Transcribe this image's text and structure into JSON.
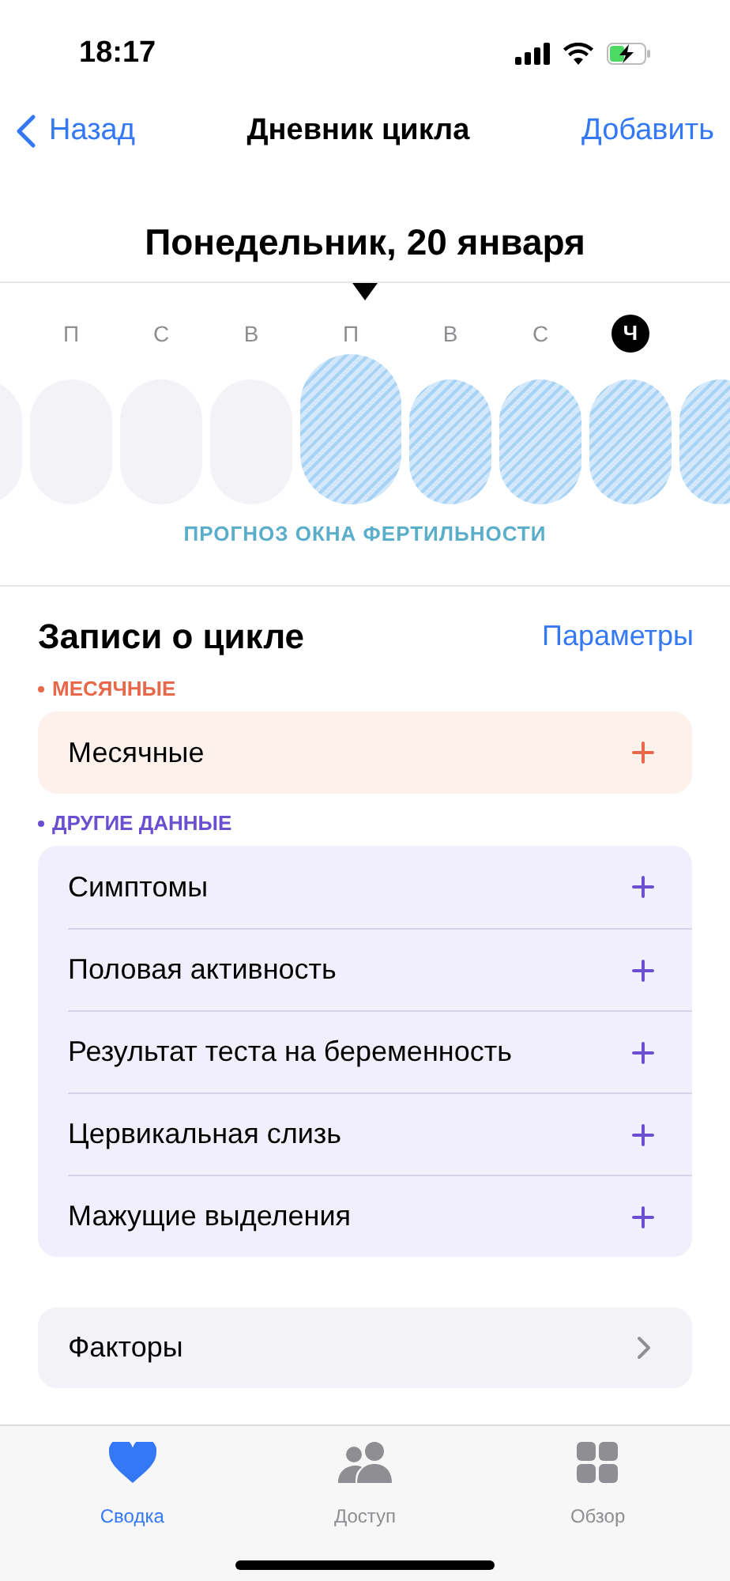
{
  "status_bar": {
    "time": "18:17"
  },
  "nav": {
    "back": "Назад",
    "title": "Дневник цикла",
    "action": "Добавить"
  },
  "date_title": "Понедельник, 20 января",
  "days": [
    {
      "kind": "empty",
      "selected": false
    },
    {
      "label": "П",
      "kind": "empty",
      "selected": false,
      "today": false
    },
    {
      "label": "С",
      "kind": "empty",
      "selected": false,
      "today": false
    },
    {
      "label": "В",
      "kind": "empty",
      "selected": false,
      "today": false
    },
    {
      "label": "П",
      "kind": "fertile",
      "selected": true,
      "today": false
    },
    {
      "label": "В",
      "kind": "fertile",
      "selected": false,
      "today": false
    },
    {
      "label": "С",
      "kind": "fertile",
      "selected": false,
      "today": false
    },
    {
      "label": "Ч",
      "kind": "fertile",
      "selected": false,
      "today": true
    },
    {
      "kind": "fertile",
      "selected": false
    }
  ],
  "legend": "ПРОГНОЗ ОКНА ФЕРТИЛЬНОСТИ",
  "section": {
    "title": "Записи о цикле",
    "action": "Параметры"
  },
  "groups": [
    {
      "title": "МЕСЯЧНЫЕ",
      "color": "#e8684a",
      "items": [
        "Месячные"
      ]
    },
    {
      "title": "ДРУГИЕ ДАННЫЕ",
      "color": "#6a4fd1",
      "items": [
        "Симптомы",
        "Половая активность",
        "Результат теста на беременность",
        "Цервикальная слизь",
        "Мажущие выделения"
      ]
    }
  ],
  "factors": "Факторы",
  "tabs": [
    {
      "label": "Сводка",
      "kind": "heart",
      "selected": true
    },
    {
      "label": "Доступ",
      "kind": "people",
      "selected": false
    },
    {
      "label": "Обзор",
      "kind": "grid",
      "selected": false
    }
  ]
}
